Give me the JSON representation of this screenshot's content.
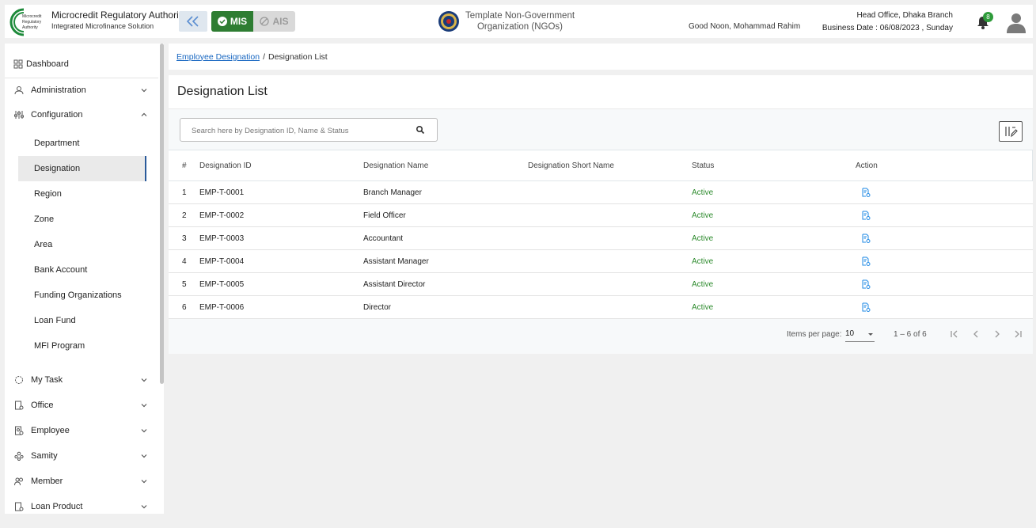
{
  "header": {
    "brand_title": "Microcredit Regulatory Authority",
    "brand_subtitle": "Integrated Microfinance Solution",
    "logo_text": [
      "Microcredit",
      "Regulatory",
      "Authority"
    ],
    "modules": {
      "mis": "MIS",
      "ais": "AIS"
    },
    "org_name_line1": "Template Non-Government",
    "org_name_line2": "Organization (NGOs)",
    "greeting": "Good Noon, Mohammad Rahim",
    "office": "Head Office, Dhaka Branch",
    "business_date": "Business Date : 06/08/2023 , Sunday",
    "notification_count": "8"
  },
  "sidebar": {
    "dashboard": "Dashboard",
    "administration": "Administration",
    "configuration": "Configuration",
    "config_items": [
      "Department",
      "Designation",
      "Region",
      "Zone",
      "Area",
      "Bank Account",
      "Funding Organizations",
      "Loan Fund",
      "MFI Program"
    ],
    "lower_items": [
      "My Task",
      "Office",
      "Employee",
      "Samity",
      "Member",
      "Loan Product"
    ]
  },
  "breadcrumb": {
    "parent": "Employee Designation",
    "separator": "/",
    "current": "Designation List"
  },
  "page": {
    "title": "Designation List",
    "search_placeholder": "Search here by Designation ID, Name & Status"
  },
  "table": {
    "columns": [
      "#",
      "Designation ID",
      "Designation Name",
      "Designation Short Name",
      "Status",
      "Action"
    ],
    "rows": [
      {
        "num": "1",
        "id": "EMP-T-0001",
        "name": "Branch Manager",
        "short": "",
        "status": "Active"
      },
      {
        "num": "2",
        "id": "EMP-T-0002",
        "name": "Field Officer",
        "short": "",
        "status": "Active"
      },
      {
        "num": "3",
        "id": "EMP-T-0003",
        "name": "Accountant",
        "short": "",
        "status": "Active"
      },
      {
        "num": "4",
        "id": "EMP-T-0004",
        "name": "Assistant Manager",
        "short": "",
        "status": "Active"
      },
      {
        "num": "5",
        "id": "EMP-T-0005",
        "name": "Assistant Director",
        "short": "",
        "status": "Active"
      },
      {
        "num": "6",
        "id": "EMP-T-0006",
        "name": "Director",
        "short": "",
        "status": "Active"
      }
    ]
  },
  "paginator": {
    "label": "Items per page:",
    "page_size": "10",
    "range": "1 – 6 of 6"
  },
  "colors": {
    "primary_green": "#2e7d32",
    "active_status": "#2e8b2e",
    "link_blue": "#1565c0",
    "icon_blue": "#1e88e5"
  }
}
